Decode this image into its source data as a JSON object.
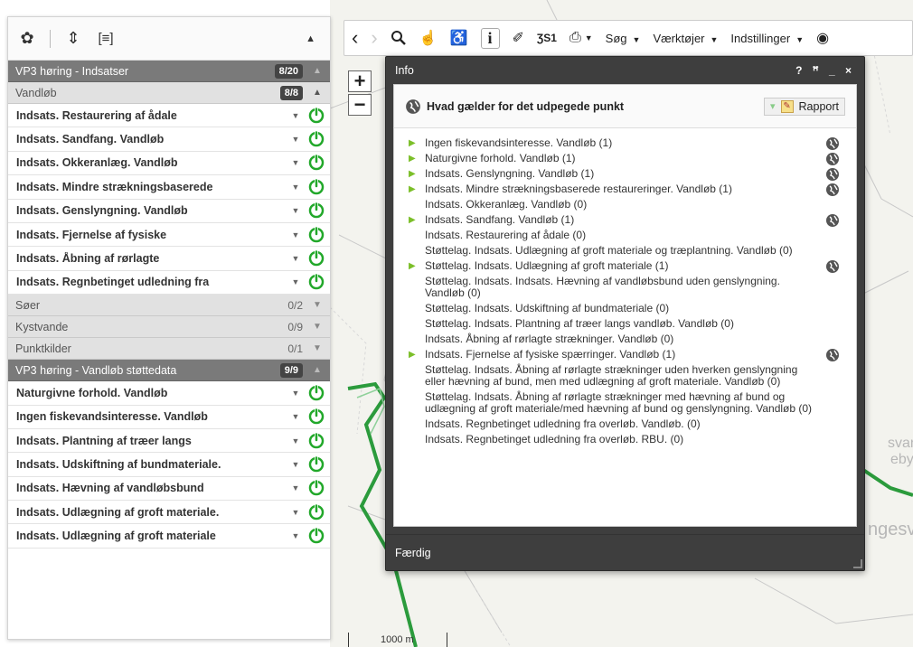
{
  "left_panel": {
    "toolbar": {
      "settings_icon": "gear-icon",
      "sort_icon": "arrows-vertical-icon",
      "list_icon": "bracket-list-icon",
      "collapse_icon": "caret-up-icon"
    },
    "groups": [
      {
        "label": "VP3 høring - Indsatser",
        "count": "8/20",
        "style": "dark",
        "badge": true
      },
      {
        "label": "Vandløb",
        "count": "8/8",
        "style": "light",
        "badge": true,
        "layers": [
          "Indsats. Restaurering af ådale",
          "Indsats. Sandfang. Vandløb",
          "Indsats. Okkeranlæg. Vandløb",
          "Indsats. Mindre strækningsbaserede",
          "Indsats. Genslyngning. Vandløb",
          "Indsats. Fjernelse af fysiske",
          "Indsats. Åbning af rørlagte",
          "Indsats. Regnbetinget udledning fra"
        ]
      },
      {
        "label": "Søer",
        "count": "0/2",
        "style": "light",
        "badge": false
      },
      {
        "label": "Kystvande",
        "count": "0/9",
        "style": "light",
        "badge": false
      },
      {
        "label": "Punktkilder",
        "count": "0/1",
        "style": "light",
        "badge": false
      },
      {
        "label": "VP3 høring - Vandløb støttedata",
        "count": "9/9",
        "style": "dark",
        "badge": true,
        "layers": [
          "Naturgivne forhold. Vandløb",
          "Ingen fiskevandsinteresse. Vandløb",
          "Indsats. Plantning af træer langs",
          "Indsats. Udskiftning af bundmateriale.",
          "Indsats. Hævning af vandløbsbund",
          "Indsats. Udlægning af groft materiale.",
          "Indsats. Udlægning af groft materiale"
        ]
      }
    ]
  },
  "map_toolbar": {
    "icons": [
      "back-icon",
      "forward-icon",
      "search-icon",
      "pan-hand-icon",
      "walker-icon",
      "info-icon",
      "measure-icon",
      "coordinate-icon",
      "print-icon"
    ],
    "coord_label": "ƷS1",
    "info_label": "i",
    "menus": [
      "Søg",
      "Værktøjer",
      "Indstillinger"
    ]
  },
  "zoom": {
    "in": "+",
    "out": "−"
  },
  "info_dialog": {
    "title": "Info",
    "controls": "? ꟸ _ ×",
    "subtitle": "Hvad gælder for det udpegede punkt",
    "report_button": "Rapport",
    "items": [
      {
        "text": "Ingen fiskevandsinteresse. Vandløb (1)",
        "expandable": true,
        "globe": true
      },
      {
        "text": "Naturgivne forhold. Vandløb (1)",
        "expandable": true,
        "globe": true
      },
      {
        "text": "Indsats. Genslyngning. Vandløb (1)",
        "expandable": true,
        "globe": true
      },
      {
        "text": "Indsats. Mindre strækningsbaserede restaureringer. Vandløb (1)",
        "expandable": true,
        "globe": true
      },
      {
        "text": "Indsats. Okkeranlæg. Vandløb (0)",
        "expandable": false,
        "globe": false
      },
      {
        "text": "Indsats. Sandfang. Vandløb (1)",
        "expandable": true,
        "globe": true
      },
      {
        "text": "Indsats. Restaurering af ådale (0)",
        "expandable": false,
        "globe": false
      },
      {
        "text": "Støttelag. Indsats. Udlægning af groft materiale og træplantning. Vandløb (0)",
        "expandable": false,
        "globe": false
      },
      {
        "text": "Støttelag. Indsats. Udlægning af groft materiale (1)",
        "expandable": true,
        "globe": true
      },
      {
        "text": "Støttelag. Indsats. Indsats. Hævning af vandløbsbund uden genslyngning. Vandløb (0)",
        "expandable": false,
        "globe": false
      },
      {
        "text": "Støttelag. Indsats. Udskiftning af bundmateriale (0)",
        "expandable": false,
        "globe": false
      },
      {
        "text": "Støttelag. Indsats. Plantning af træer langs vandløb. Vandløb (0)",
        "expandable": false,
        "globe": false
      },
      {
        "text": "Indsats. Åbning af rørlagte strækninger. Vandløb (0)",
        "expandable": false,
        "globe": false
      },
      {
        "text": "Indsats. Fjernelse af fysiske spærringer. Vandløb (1)",
        "expandable": true,
        "globe": true
      },
      {
        "text": "Støttelag. Indsats. Åbning af rørlagte strækninger uden hverken genslyngning eller hævning af bund, men med udlægning af groft materiale. Vandløb (0)",
        "expandable": false,
        "globe": false
      },
      {
        "text": "Støttelag. Indsats. Åbning af rørlagte strækninger med hævning af bund og udlægning af groft materiale/med hævning af bund og genslyngning. Vandløb (0)",
        "expandable": false,
        "globe": false
      },
      {
        "text": "Indsats. Regnbetinget udledning fra overløb. Vandløb. (0)",
        "expandable": false,
        "globe": false
      },
      {
        "text": "Indsats. Regnbetinget udledning fra overløb. RBU. (0)",
        "expandable": false,
        "globe": false
      }
    ],
    "footer_button": "Færdig"
  },
  "map": {
    "labels": [
      "svang",
      "eby",
      "ngesv"
    ],
    "scale": "1000 m"
  },
  "colors": {
    "accent_green": "#22a82a",
    "river_green": "#2b9b3c",
    "dialog_dark": "#3e3e3e",
    "group_dark": "#7a7a7a",
    "group_light": "#e1e1e1"
  }
}
